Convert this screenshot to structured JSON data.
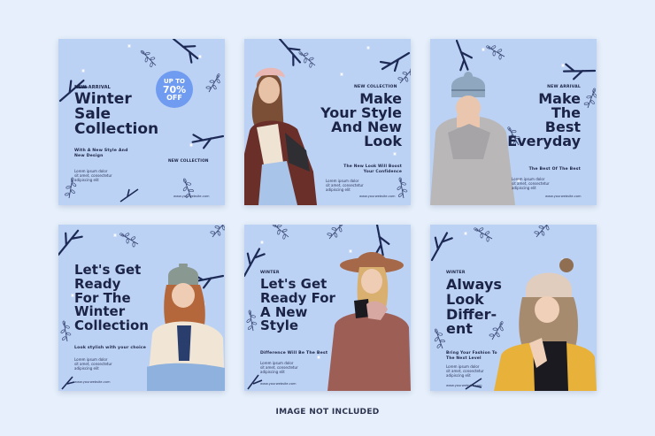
{
  "cards": [
    {
      "tag": "NEW ARRIVAL",
      "title_lines": [
        "Winter",
        "Sale",
        "Collection"
      ],
      "subtitle_lines": [
        "With A New Style And",
        "New Design"
      ],
      "badge_lines": [
        "UP TO",
        "70%",
        "OFF"
      ],
      "tag2": "NEW COLLECTION",
      "body_lines": [
        "Lorem ipsum dolor",
        "sit amet, consectetur",
        "adipiscing elit"
      ],
      "url": "www.yourwebsite.com"
    },
    {
      "tag": "NEW COLLECTION",
      "title_lines": [
        "Make",
        "Your Style",
        "And New",
        "Look"
      ],
      "subtitle_lines": [
        "The New Look Will Boost",
        "Your Confidence"
      ],
      "body_lines": [
        "Lorem ipsum dolor",
        "sit amet, consectetur",
        "adipiscing elit"
      ],
      "url": "www.yourwebsite.com"
    },
    {
      "tag": "NEW ARRIVAL",
      "title_lines": [
        "Make",
        "The",
        "Best",
        "Everyday"
      ],
      "subtitle_lines": [
        "The Best Of The Best"
      ],
      "body_lines": [
        "Lorem ipsum dolor",
        "sit amet, consectetur",
        "adipiscing elit"
      ],
      "url": "www.yourwebsite.com"
    },
    {
      "title_lines": [
        "Let's Get",
        "Ready",
        "For The",
        "Winter",
        "Collection"
      ],
      "subtitle_lines": [
        "Look stylish with your choice"
      ],
      "body_lines": [
        "Lorem ipsum dolor",
        "sit amet, consectetur",
        "adipiscing elit"
      ],
      "url": "www.yourwebsite.com"
    },
    {
      "tag": "WINTER",
      "title_lines": [
        "Let's Get",
        "Ready For",
        "A New",
        "Style"
      ],
      "subtitle_lines": [
        "Difference Will Be The Best"
      ],
      "body_lines": [
        "Lorem ipsum dolor",
        "sit amet, consectetur",
        "adipiscing elit"
      ],
      "url": "www.yourwebsite.com"
    },
    {
      "tag": "WINTER",
      "title_lines": [
        "Always",
        "Look",
        "Differ-",
        "ent"
      ],
      "subtitle_lines": [
        "Bring Your Fashion To",
        "The Next Level"
      ],
      "body_lines": [
        "Lorem ipsum dolor",
        "sit amet, consectetur",
        "adipiscing elit"
      ],
      "url": "www.yourwebsite.com"
    }
  ],
  "footer": "IMAGE NOT INCLUDED",
  "colors": {
    "background": "#e6effb",
    "card": "#bcd2f5",
    "text": "#1b2446",
    "badge": "#6f9bf0"
  }
}
